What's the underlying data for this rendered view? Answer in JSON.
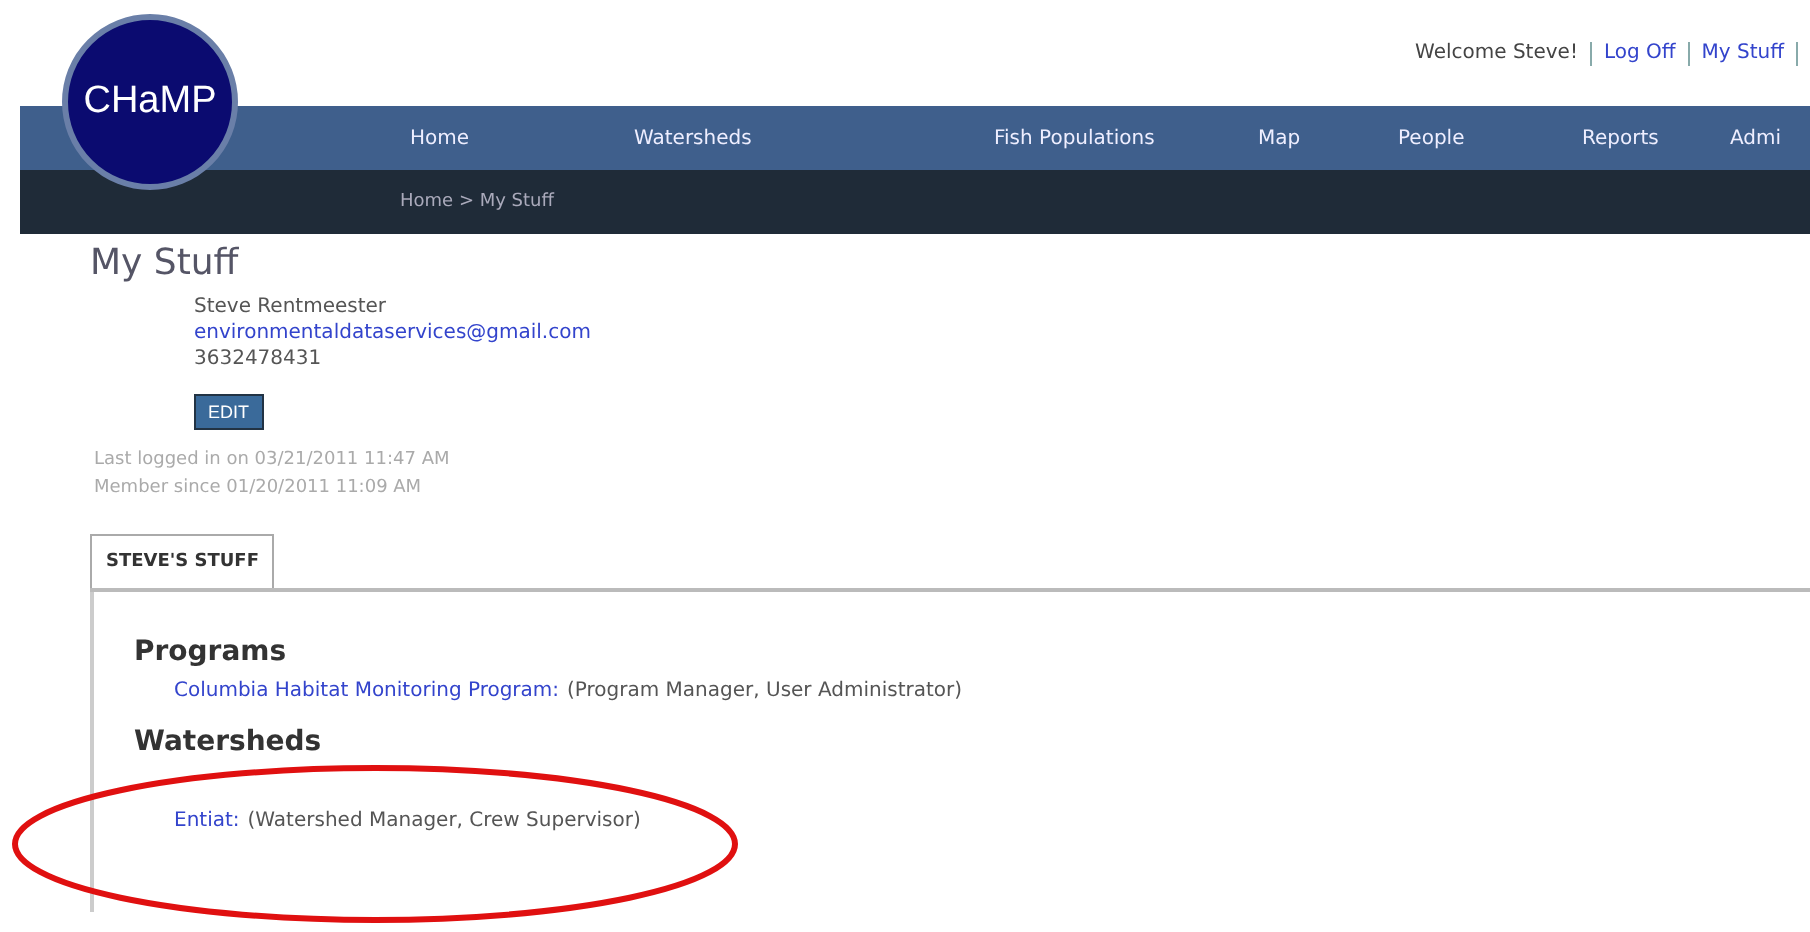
{
  "logo": {
    "text": "CHaMP"
  },
  "top_links": {
    "welcome": "Welcome Steve!",
    "links": [
      "Log Off",
      "My Stuff"
    ]
  },
  "nav": [
    "Home",
    "Watersheds",
    "Fish Populations",
    "Map",
    "People",
    "Reports",
    "Admi"
  ],
  "breadcrumb": "Home > My Stuff",
  "page_title": "My Stuff",
  "profile": {
    "name": "Steve Rentmeester",
    "email": "environmentaldataservices@gmail.com",
    "phone": "3632478431",
    "edit_button": "EDIT"
  },
  "last_login": "Last logged in on 03/21/2011 11:47 AM",
  "member_since": "Member since 01/20/2011 11:09 AM",
  "tabs": [
    {
      "label": "STEVE'S STUFF",
      "selected": true
    }
  ],
  "sections": [
    {
      "heading": "Programs",
      "items": [
        {
          "link": "Columbia Habitat Monitoring Program:",
          "roles": "(Program Manager, User Administrator)"
        }
      ]
    },
    {
      "heading": "Watersheds",
      "items": [
        {
          "link": "Entiat:",
          "roles": "(Watershed Manager, Crew Supervisor)"
        }
      ]
    }
  ]
}
